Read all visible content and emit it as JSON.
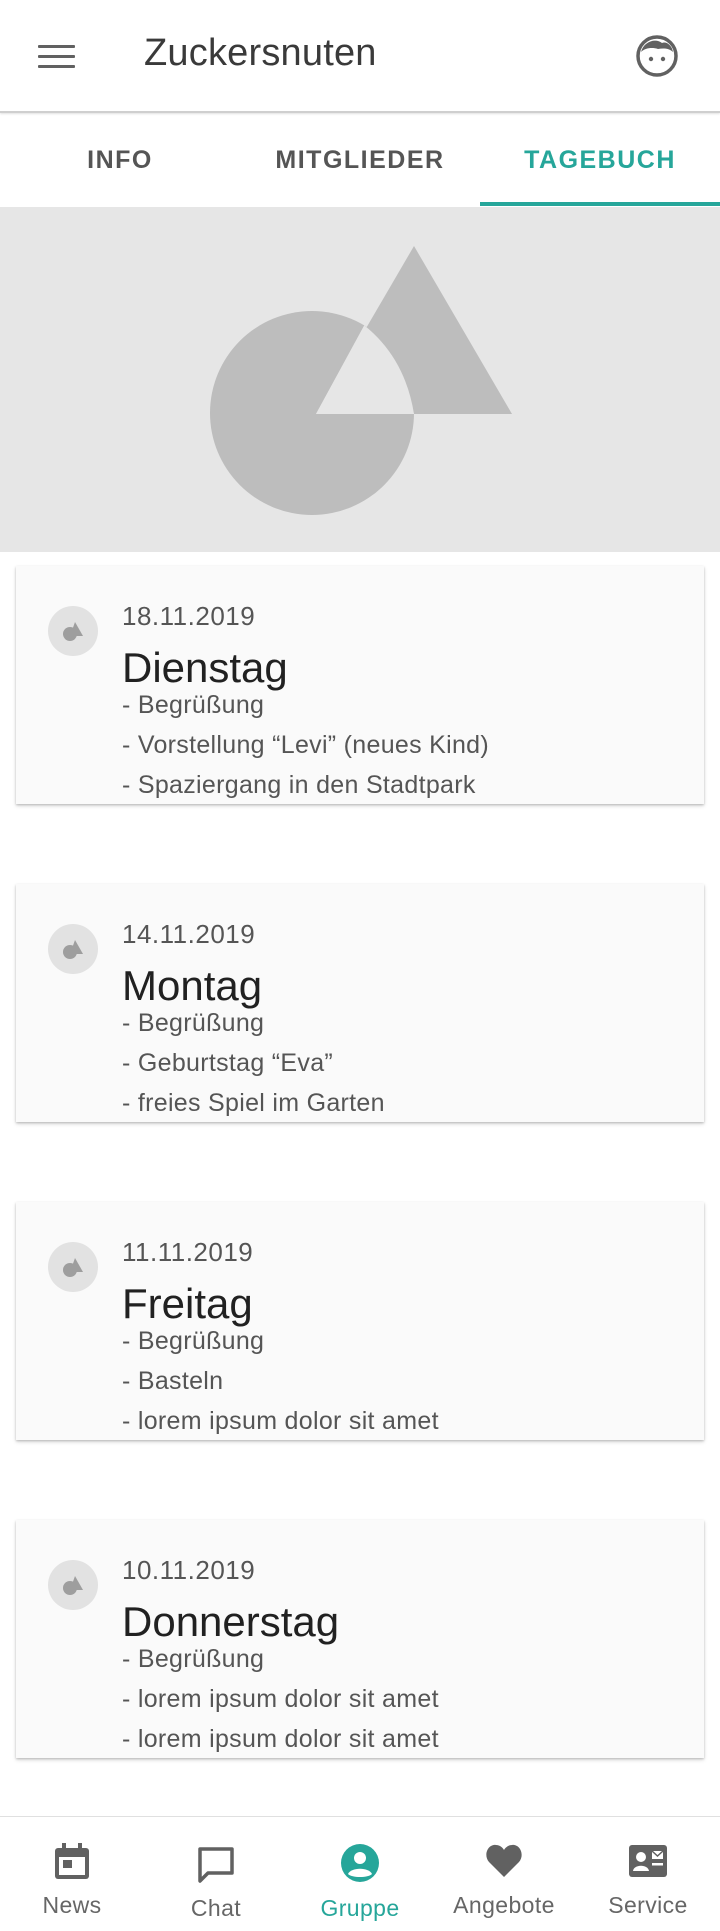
{
  "app": {
    "title": "Zuckersnuten"
  },
  "icons": {
    "menu": "menu-icon",
    "account": "child-face-icon",
    "hero": "image-placeholder-icon",
    "entry": "entry-avatar-icon"
  },
  "colors": {
    "accent": "#26a69a",
    "hero_bg": "#e6e6e6",
    "placeholder_shape": "#bdbdbd"
  },
  "tabs": [
    {
      "label": "INFO",
      "active": false
    },
    {
      "label": "MITGLIEDER",
      "active": false
    },
    {
      "label": "TAGEBUCH",
      "active": true
    }
  ],
  "entries": [
    {
      "date": "18.11.2019",
      "day": "Dienstag",
      "lines": [
        "- Begrüßung",
        "- Vorstellung “Levi” (neues Kind)",
        "- Spaziergang in den Stadtpark"
      ]
    },
    {
      "date": "14.11.2019",
      "day": "Montag",
      "lines": [
        "- Begrüßung",
        "- Geburtstag “Eva”",
        "- freies Spiel im Garten"
      ]
    },
    {
      "date": "11.11.2019",
      "day": "Freitag",
      "lines": [
        "- Begrüßung",
        "- Basteln",
        "- lorem ipsum dolor sit amet"
      ]
    },
    {
      "date": "10.11.2019",
      "day": "Donnerstag",
      "lines": [
        "- Begrüßung",
        "- lorem ipsum dolor sit amet",
        "- lorem ipsum dolor sit amet"
      ]
    }
  ],
  "bottom_nav": [
    {
      "label": "News",
      "icon": "calendar-icon",
      "active": false
    },
    {
      "label": "Chat",
      "icon": "chat-bubble-icon",
      "active": false
    },
    {
      "label": "Gruppe",
      "icon": "account-circle-icon",
      "active": true
    },
    {
      "label": "Angebote",
      "icon": "heart-icon",
      "active": false
    },
    {
      "label": "Service",
      "icon": "contact-card-icon",
      "active": false
    }
  ]
}
